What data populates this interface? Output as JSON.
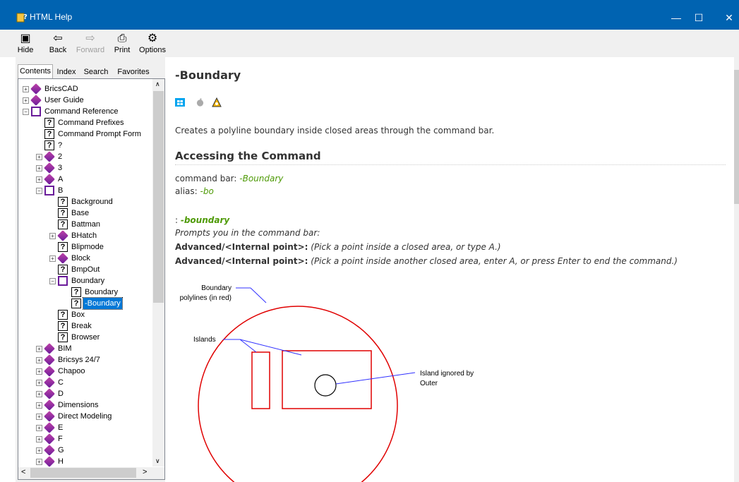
{
  "window": {
    "title": "HTML Help",
    "controls": {
      "minimize": "—",
      "maximize": "☐",
      "close": "✕"
    }
  },
  "toolbar": {
    "hide": "Hide",
    "back": "Back",
    "forward": "Forward",
    "print": "Print",
    "options": "Options"
  },
  "nav_tabs": [
    "Contents",
    "Index",
    "Search",
    "Favorites"
  ],
  "tree": [
    {
      "label": "BricsCAD",
      "type": "book"
    },
    {
      "label": "User Guide",
      "type": "book"
    },
    {
      "label": "Command Reference",
      "type": "open"
    },
    {
      "label": "Command Prefixes",
      "type": "topic"
    },
    {
      "label": "Command Prompt Form",
      "type": "topic"
    },
    {
      "label": "?",
      "type": "topic"
    },
    {
      "label": "2",
      "type": "book"
    },
    {
      "label": "3",
      "type": "book"
    },
    {
      "label": "A",
      "type": "book"
    },
    {
      "label": "B",
      "type": "open"
    },
    {
      "label": "Background",
      "type": "topic"
    },
    {
      "label": "Base",
      "type": "topic"
    },
    {
      "label": "Battman",
      "type": "topic"
    },
    {
      "label": "BHatch",
      "type": "book"
    },
    {
      "label": "Blipmode",
      "type": "topic"
    },
    {
      "label": "Block",
      "type": "book"
    },
    {
      "label": "BmpOut",
      "type": "topic"
    },
    {
      "label": "Boundary",
      "type": "open"
    },
    {
      "label": "Boundary",
      "type": "topic"
    },
    {
      "label": "-Boundary",
      "type": "topic",
      "selected": true
    },
    {
      "label": "Box",
      "type": "topic"
    },
    {
      "label": "Break",
      "type": "topic"
    },
    {
      "label": "Browser",
      "type": "topic"
    },
    {
      "label": "BIM",
      "type": "book"
    },
    {
      "label": "Bricsys 24/7",
      "type": "book"
    },
    {
      "label": "Chapoo",
      "type": "book"
    },
    {
      "label": "C",
      "type": "book"
    },
    {
      "label": "D",
      "type": "book"
    },
    {
      "label": "Dimensions",
      "type": "book"
    },
    {
      "label": "Direct Modeling",
      "type": "book"
    },
    {
      "label": "E",
      "type": "book"
    },
    {
      "label": "F",
      "type": "book"
    },
    {
      "label": "G",
      "type": "book"
    },
    {
      "label": "H",
      "type": "book"
    }
  ],
  "content": {
    "title": "-Boundary",
    "platforms": [
      "windows-icon",
      "apple-icon",
      "linux-icon"
    ],
    "description": "Creates a polyline boundary inside closed areas through the command bar.",
    "section_heading": "Accessing the Command",
    "command_bar_label": "command bar:",
    "command_bar_value": "-Boundary",
    "alias_label": "alias:",
    "alias_value": "-bo",
    "prompt_prefix": ": ",
    "prompt_command": "-boundary",
    "prompts_line": "Prompts you in the command bar:",
    "option1_label": "Advanced/<Internal point>:",
    "option1_text": "(Pick a point inside a closed area, or type A.)",
    "option2_label": "Advanced/<Internal point>:",
    "option2_text": "(Pick a point inside another closed area, enter A, or press Enter to end the command.)"
  },
  "diagram": {
    "label_boundary": "Boundary",
    "label_polylines": "polylines (in red)",
    "label_islands": "Islands",
    "label_island_ignored": "Island ignored by",
    "label_outer": "Outer"
  },
  "colors": {
    "titlebar": "#0063b1",
    "selection": "#0078d7",
    "accent_green": "#4e9a06",
    "diagram_red": "#e00000",
    "diagram_blue": "#3030ff"
  }
}
